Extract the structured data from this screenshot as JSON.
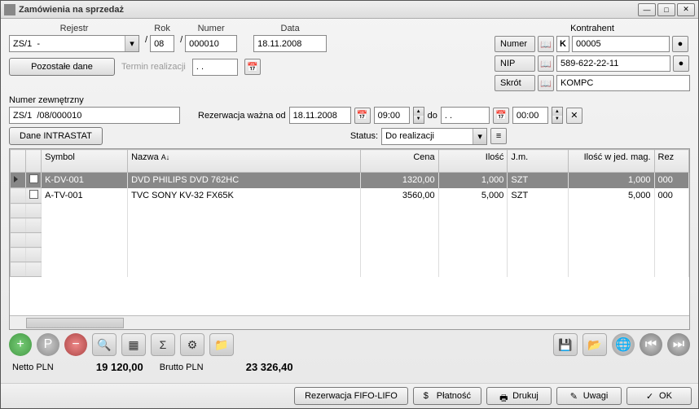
{
  "title": "Zamówienia na sprzedaż",
  "header": {
    "rejestr_label": "Rejestr",
    "rejestr_value": "ZS/1  -",
    "rok_label": "Rok",
    "rok_value": "08",
    "numer_label": "Numer",
    "numer_value": "000010",
    "data_label": "Data",
    "data_value": "18.11.2008"
  },
  "kontrahent": {
    "label": "Kontrahent",
    "numer_btn": "Numer",
    "k_prefix": "K",
    "numer_value": "00005",
    "nip_btn": "NIP",
    "nip_value": "589-622-22-11",
    "skrot_btn": "Skrót",
    "skrot_value": "KOMPC"
  },
  "row2": {
    "pozostale": "Pozostałe dane",
    "termin": "Termin realizacji",
    "termin_value": ". ."
  },
  "ext": {
    "label": "Numer zewnętrzny",
    "value": "ZS/1  /08/000010",
    "rezerwacja": "Rezerwacja ważna od",
    "date_from": "18.11.2008",
    "time_from": "09:00",
    "do": "do",
    "date_to": ". .",
    "time_to": "00:00"
  },
  "row4": {
    "intrastat": "Dane INTRASTAT",
    "status_label": "Status:",
    "status_value": "Do realizacji"
  },
  "grid": {
    "cols": [
      "Symbol",
      "Nazwa",
      "Cena",
      "Ilość",
      "J.m.",
      "Ilość w jed. mag.",
      "Rez"
    ],
    "rows": [
      {
        "symbol": "K-DV-001",
        "nazwa": "DVD  PHILIPS DVD 762HC",
        "cena": "1320,00",
        "ilosc": "1,000",
        "jm": "SZT",
        "iloscw": "1,000",
        "rez": "000"
      },
      {
        "symbol": "A-TV-001",
        "nazwa": "TVC SONY KV-32 FX65K",
        "cena": "3560,00",
        "ilosc": "5,000",
        "jm": "SZT",
        "iloscw": "5,000",
        "rez": "000"
      }
    ]
  },
  "totals": {
    "netto_label": "Netto PLN",
    "netto_value": "19 120,00",
    "brutto_label": "Brutto PLN",
    "brutto_value": "23 326,40"
  },
  "footer": {
    "fifo": "Rezerwacja FIFO-LIFO",
    "platnosc": "Płatność",
    "drukuj": "Drukuj",
    "uwagi": "Uwagi",
    "ok": "OK"
  },
  "icons": {
    "add": "+",
    "pay": "P",
    "remove": "−",
    "search": "🔍",
    "grid": "▦",
    "sum": "Σ",
    "gears": "⚙",
    "folder": "📁",
    "save": "💾",
    "open": "📂",
    "globe": "🌐",
    "first": "⏮",
    "last": "⏭",
    "check": "✓",
    "printer": "🖶",
    "note": "✎",
    "money": "$",
    "cal": "📅",
    "book": "📖",
    "ball": "●",
    "apple": "●"
  }
}
